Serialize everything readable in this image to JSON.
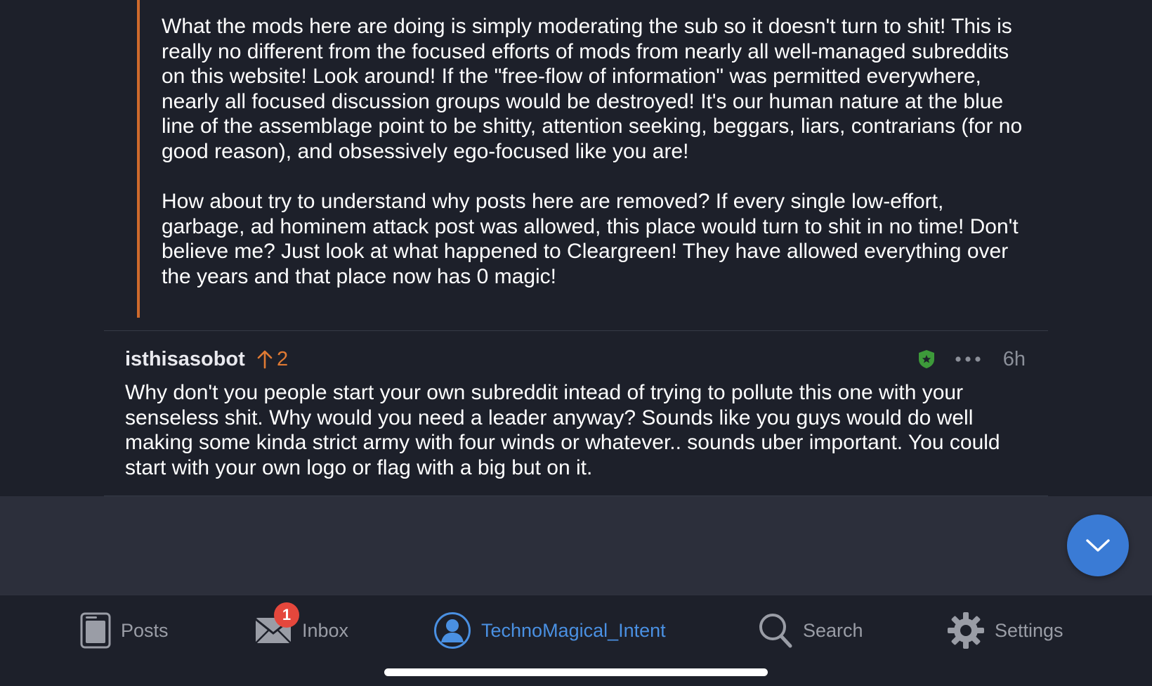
{
  "parent_comment": {
    "paragraphs": [
      "What the mods here are doing is simply moderating the sub so it doesn't turn to shit! This is really no different from the focused efforts of mods from nearly all well-managed subreddits on this website! Look around! If the \"free-flow of information\" was permitted everywhere, nearly all focused discussion groups would be destroyed! It's our human nature at the blue line of the assemblage point to be shitty, attention seeking, beggars, liars, contrarians (for no good reason), and obsessively ego-focused like you are!",
      "How about try to understand why posts here are removed? If every single low-effort, garbage, ad hominem attack post was allowed, this place would turn to shit in no time! Don't believe me? Just look at what happened to Cleargreen! They have allowed everything over the years and that place now has 0 magic!"
    ],
    "accent_color": "#cf6a2c"
  },
  "reply_comment": {
    "username": "isthisasobot",
    "score": "2",
    "timestamp": "6h",
    "body": "Why don't you people start your own subreddit intead of trying to pollute this one with your senseless shit. Why would you need a leader anyway? Sounds like you guys would do well making some kinda strict army with four winds or whatever.. sounds uber important. You could start with your own logo or flag with a big but on it.",
    "vote_color": "#e07a33",
    "badge_icon": "moderator-shield-icon",
    "badge_color": "#3d9a3a"
  },
  "scroll_button": {
    "icon": "chevron-down-icon",
    "color": "#3a7bd5"
  },
  "tab_bar": {
    "tabs": [
      {
        "label": "Posts",
        "icon": "posts-icon",
        "active": false
      },
      {
        "label": "Inbox",
        "icon": "mail-icon",
        "badge": "1",
        "active": false
      },
      {
        "label": "TechnoMagical_Intent",
        "icon": "user-avatar-icon",
        "active": true
      },
      {
        "label": "Search",
        "icon": "search-icon",
        "active": false
      },
      {
        "label": "Settings",
        "icon": "gear-icon",
        "active": false
      }
    ],
    "active_color": "#4a90e2",
    "badge_color": "#e5473c"
  }
}
